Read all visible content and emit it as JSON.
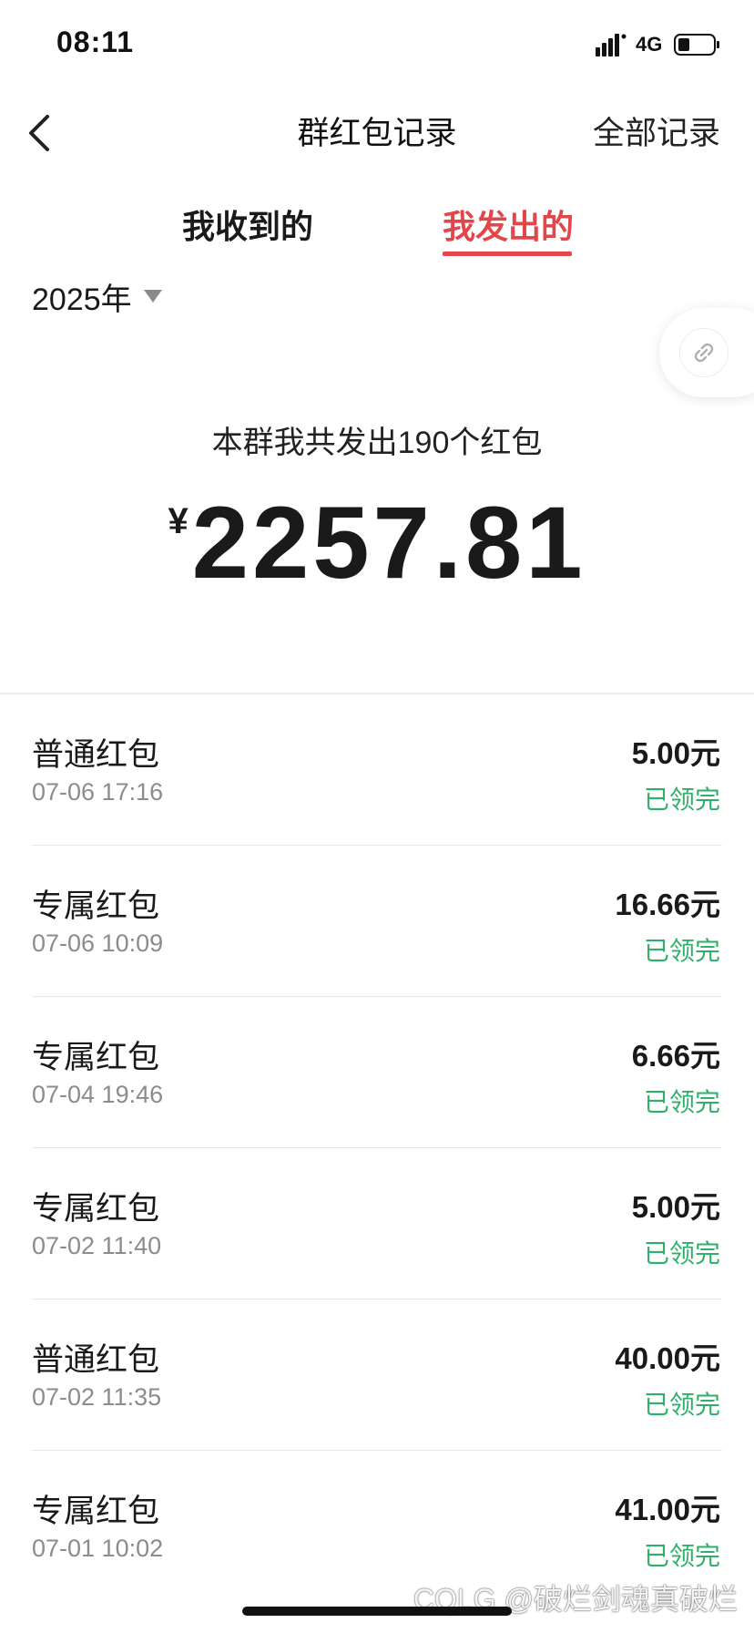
{
  "status_bar": {
    "time": "08:11",
    "network": "4G",
    "icons": [
      "signal-icon",
      "battery-icon"
    ]
  },
  "nav": {
    "title": "群红包记录",
    "right_action": "全部记录",
    "back_icon": "chevron-left-icon"
  },
  "tabs": [
    {
      "label": "我收到的",
      "active": false
    },
    {
      "label": "我发出的",
      "active": true
    }
  ],
  "accent_color": "#e0464a",
  "status_color": "#2fb06a",
  "year_filter": {
    "label": "2025年",
    "icon": "caret-down-icon"
  },
  "floating_button": {
    "icon": "link-icon"
  },
  "summary": {
    "text": "本群我共发出190个红包",
    "currency": "¥",
    "total": "2257.81"
  },
  "records": [
    {
      "type": "普通红包",
      "time": "07-06 17:16",
      "amount": "5.00元",
      "status": "已领完"
    },
    {
      "type": "专属红包",
      "time": "07-06 10:09",
      "amount": "16.66元",
      "status": "已领完"
    },
    {
      "type": "专属红包",
      "time": "07-04 19:46",
      "amount": "6.66元",
      "status": "已领完"
    },
    {
      "type": "专属红包",
      "time": "07-02 11:40",
      "amount": "5.00元",
      "status": "已领完"
    },
    {
      "type": "普通红包",
      "time": "07-02 11:35",
      "amount": "40.00元",
      "status": "已领完"
    },
    {
      "type": "专属红包",
      "time": "07-01 10:02",
      "amount": "41.00元",
      "status": "已领完"
    }
  ],
  "watermark": "CQLG @破烂剑魂真破烂"
}
